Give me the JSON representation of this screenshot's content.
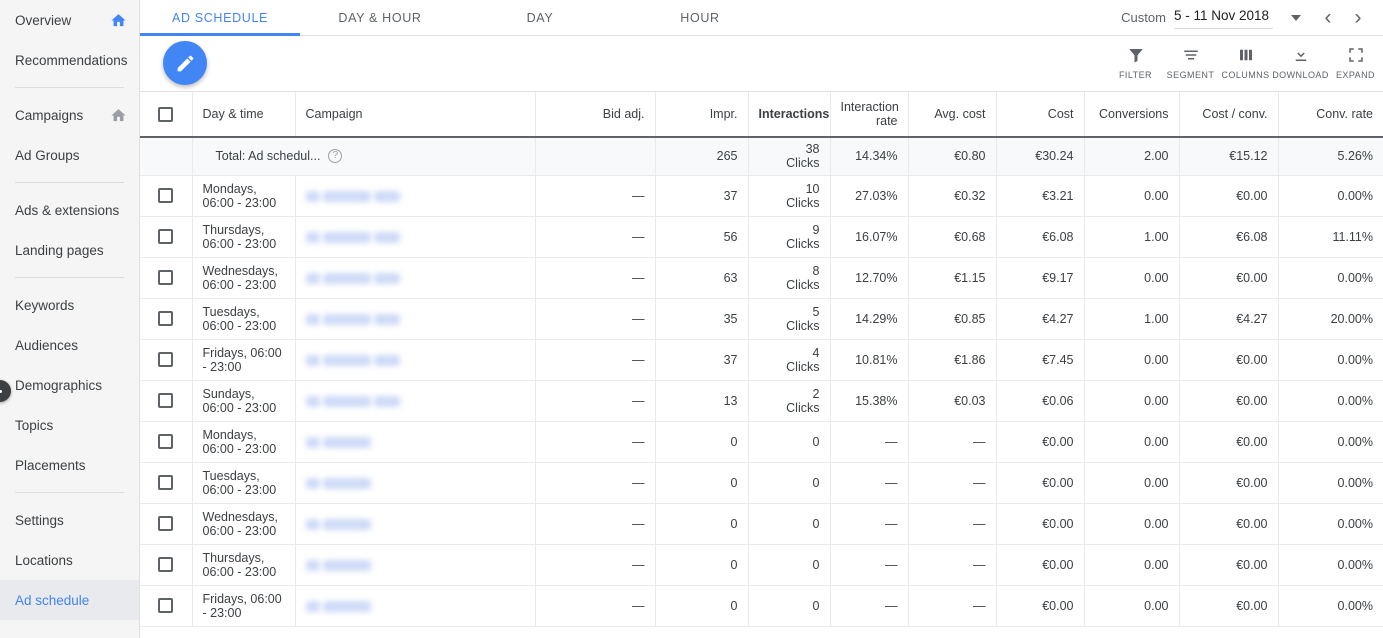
{
  "sidebar": {
    "groups": [
      {
        "items": [
          {
            "label": "Overview",
            "icon": "home-icon",
            "icon_color": "#4285f4",
            "active": false
          },
          {
            "label": "Recommendations",
            "icon": null,
            "active": false
          }
        ]
      },
      {
        "items": [
          {
            "label": "Campaigns",
            "icon": "home-icon",
            "icon_color": "#9aa0a6",
            "active": false
          },
          {
            "label": "Ad Groups",
            "icon": null,
            "active": false
          }
        ]
      },
      {
        "items": [
          {
            "label": "Ads & extensions",
            "icon": null,
            "active": false
          },
          {
            "label": "Landing pages",
            "icon": null,
            "active": false
          }
        ]
      },
      {
        "items": [
          {
            "label": "Keywords",
            "icon": null,
            "active": false
          },
          {
            "label": "Audiences",
            "icon": null,
            "active": false
          },
          {
            "label": "Demographics",
            "icon": null,
            "active": false
          },
          {
            "label": "Topics",
            "icon": null,
            "active": false
          },
          {
            "label": "Placements",
            "icon": null,
            "active": false
          }
        ]
      },
      {
        "items": [
          {
            "label": "Settings",
            "icon": null,
            "active": false
          },
          {
            "label": "Locations",
            "icon": null,
            "active": false
          },
          {
            "label": "Ad schedule",
            "icon": null,
            "active": true
          }
        ]
      }
    ]
  },
  "tabs": [
    {
      "label": "AD SCHEDULE",
      "active": true
    },
    {
      "label": "DAY & HOUR",
      "active": false
    },
    {
      "label": "DAY",
      "active": false
    },
    {
      "label": "HOUR",
      "active": false
    }
  ],
  "date_range": {
    "preset_label": "Custom",
    "value": "5 - 11 Nov 2018",
    "prev_icon": "chevron-left-icon",
    "next_icon": "chevron-right-icon",
    "caret_icon": "chevron-down-icon"
  },
  "toolbar": {
    "edit_fab_icon": "pencil-icon",
    "tools": [
      {
        "label": "FILTER",
        "icon": "filter-icon"
      },
      {
        "label": "SEGMENT",
        "icon": "segment-icon"
      },
      {
        "label": "COLUMNS",
        "icon": "columns-icon"
      },
      {
        "label": "DOWNLOAD",
        "icon": "download-icon"
      },
      {
        "label": "EXPAND",
        "icon": "expand-icon"
      }
    ]
  },
  "table": {
    "select_all_icon": "checkbox-icon",
    "columns": [
      {
        "key": "daytime",
        "label": "Day & time",
        "align": "left",
        "bold": false
      },
      {
        "key": "campaign",
        "label": "Campaign",
        "align": "left",
        "bold": false
      },
      {
        "key": "bidadj",
        "label": "Bid adj.",
        "align": "right",
        "bold": false
      },
      {
        "key": "impr",
        "label": "Impr.",
        "align": "right",
        "bold": false
      },
      {
        "key": "interactions",
        "label": "Interactions",
        "align": "right",
        "bold": true
      },
      {
        "key": "intrate",
        "label": "Interaction rate",
        "align": "right",
        "bold": false
      },
      {
        "key": "avgcost",
        "label": "Avg. cost",
        "align": "right",
        "bold": false
      },
      {
        "key": "cost",
        "label": "Cost",
        "align": "right",
        "bold": false
      },
      {
        "key": "conversions",
        "label": "Conversions",
        "align": "right",
        "bold": false
      },
      {
        "key": "costconv",
        "label": "Cost / conv.",
        "align": "right",
        "bold": false
      },
      {
        "key": "convrate",
        "label": "Conv. rate",
        "align": "right",
        "bold": false
      }
    ],
    "total_row": {
      "label": "Total: Ad schedul...",
      "help_icon": "help-icon",
      "bidadj": "",
      "impr": "265",
      "interactions": "38",
      "interactions_unit": "Clicks",
      "intrate": "14.34%",
      "avgcost": "€0.80",
      "cost": "€30.24",
      "conversions": "2.00",
      "costconv": "€15.12",
      "convrate": "5.26%"
    },
    "rows": [
      {
        "daytime": "Mondays, 06:00 - 23:00",
        "campaign_redacted": "long",
        "bidadj": "—",
        "impr": "37",
        "interactions": "10",
        "interactions_unit": "Clicks",
        "intrate": "27.03%",
        "avgcost": "€0.32",
        "cost": "€3.21",
        "conversions": "0.00",
        "costconv": "€0.00",
        "convrate": "0.00%"
      },
      {
        "daytime": "Thursdays, 06:00 - 23:00",
        "campaign_redacted": "long",
        "bidadj": "—",
        "impr": "56",
        "interactions": "9",
        "interactions_unit": "Clicks",
        "intrate": "16.07%",
        "avgcost": "€0.68",
        "cost": "€6.08",
        "conversions": "1.00",
        "costconv": "€6.08",
        "convrate": "11.11%"
      },
      {
        "daytime": "Wednesdays, 06:00 - 23:00",
        "campaign_redacted": "long",
        "bidadj": "—",
        "impr": "63",
        "interactions": "8",
        "interactions_unit": "Clicks",
        "intrate": "12.70%",
        "avgcost": "€1.15",
        "cost": "€9.17",
        "conversions": "0.00",
        "costconv": "€0.00",
        "convrate": "0.00%"
      },
      {
        "daytime": "Tuesdays, 06:00 - 23:00",
        "campaign_redacted": "long",
        "bidadj": "—",
        "impr": "35",
        "interactions": "5",
        "interactions_unit": "Clicks",
        "intrate": "14.29%",
        "avgcost": "€0.85",
        "cost": "€4.27",
        "conversions": "1.00",
        "costconv": "€4.27",
        "convrate": "20.00%"
      },
      {
        "daytime": "Fridays, 06:00 - 23:00",
        "campaign_redacted": "long",
        "bidadj": "—",
        "impr": "37",
        "interactions": "4",
        "interactions_unit": "Clicks",
        "intrate": "10.81%",
        "avgcost": "€1.86",
        "cost": "€7.45",
        "conversions": "0.00",
        "costconv": "€0.00",
        "convrate": "0.00%"
      },
      {
        "daytime": "Sundays, 06:00 - 23:00",
        "campaign_redacted": "long",
        "bidadj": "—",
        "impr": "13",
        "interactions": "2",
        "interactions_unit": "Clicks",
        "intrate": "15.38%",
        "avgcost": "€0.03",
        "cost": "€0.06",
        "conversions": "0.00",
        "costconv": "€0.00",
        "convrate": "0.00%"
      },
      {
        "daytime": "Mondays, 06:00 - 23:00",
        "campaign_redacted": "short",
        "bidadj": "—",
        "impr": "0",
        "interactions": "0",
        "interactions_unit": "",
        "intrate": "—",
        "avgcost": "—",
        "cost": "€0.00",
        "conversions": "0.00",
        "costconv": "€0.00",
        "convrate": "0.00%"
      },
      {
        "daytime": "Tuesdays, 06:00 - 23:00",
        "campaign_redacted": "short",
        "bidadj": "—",
        "impr": "0",
        "interactions": "0",
        "interactions_unit": "",
        "intrate": "—",
        "avgcost": "—",
        "cost": "€0.00",
        "conversions": "0.00",
        "costconv": "€0.00",
        "convrate": "0.00%"
      },
      {
        "daytime": "Wednesdays, 06:00 - 23:00",
        "campaign_redacted": "short",
        "bidadj": "—",
        "impr": "0",
        "interactions": "0",
        "interactions_unit": "",
        "intrate": "—",
        "avgcost": "—",
        "cost": "€0.00",
        "conversions": "0.00",
        "costconv": "€0.00",
        "convrate": "0.00%"
      },
      {
        "daytime": "Thursdays, 06:00 - 23:00",
        "campaign_redacted": "short",
        "bidadj": "—",
        "impr": "0",
        "interactions": "0",
        "interactions_unit": "",
        "intrate": "—",
        "avgcost": "—",
        "cost": "€0.00",
        "conversions": "0.00",
        "costconv": "€0.00",
        "convrate": "0.00%"
      },
      {
        "daytime": "Fridays, 06:00 - 23:00",
        "campaign_redacted": "short",
        "bidadj": "—",
        "impr": "0",
        "interactions": "0",
        "interactions_unit": "",
        "intrate": "—",
        "avgcost": "—",
        "cost": "€0.00",
        "conversions": "0.00",
        "costconv": "€0.00",
        "convrate": "0.00%"
      }
    ]
  },
  "colors": {
    "accent": "#4285f4",
    "sidebar_bg": "#f5f5f5",
    "active_bg": "#e8eaed",
    "total_bg": "#f8f9fa",
    "text": "#3c4043",
    "muted": "#5f6368"
  }
}
